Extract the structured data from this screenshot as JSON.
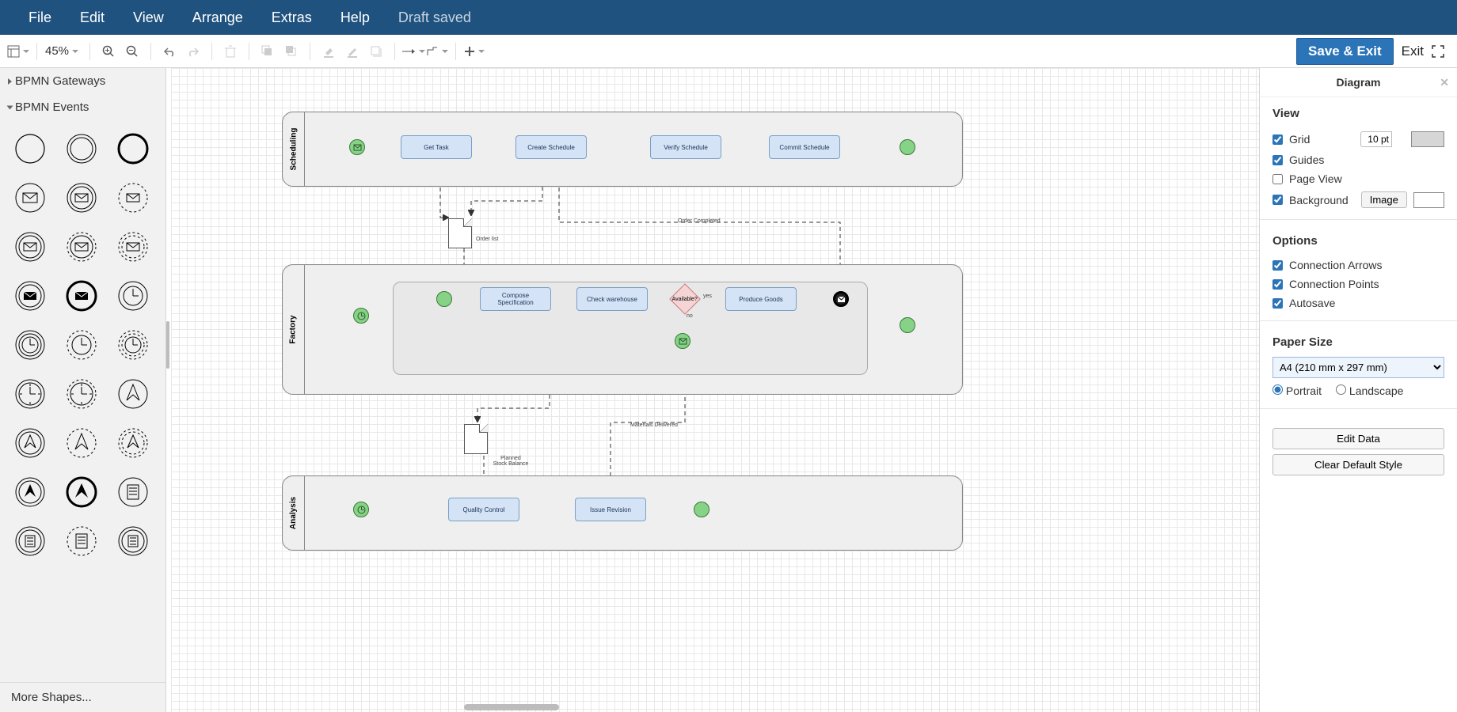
{
  "menubar": {
    "items": [
      "File",
      "Edit",
      "View",
      "Arrange",
      "Extras",
      "Help"
    ],
    "draft_saved": "Draft saved"
  },
  "toolbar": {
    "zoom": "45%",
    "save_exit": "Save & Exit",
    "exit": "Exit"
  },
  "sidebar": {
    "sections": [
      {
        "title": "BPMN Gateways",
        "expanded": false
      },
      {
        "title": "BPMN Events",
        "expanded": true
      }
    ],
    "more_shapes": "More Shapes..."
  },
  "props": {
    "header": "Diagram",
    "view_h": "View",
    "grid": "Grid",
    "grid_val": "10 pt",
    "guides": "Guides",
    "page_view": "Page View",
    "background": "Background",
    "image_btn": "Image",
    "options_h": "Options",
    "conn_arrows": "Connection Arrows",
    "conn_points": "Connection Points",
    "autosave": "Autosave",
    "paper_h": "Paper Size",
    "paper_sel": "A4 (210 mm x 297 mm)",
    "portrait": "Portrait",
    "landscape": "Landscape",
    "edit_data": "Edit Data",
    "clear_style": "Clear Default Style"
  },
  "diagram": {
    "lanes": [
      {
        "title": "Scheduling"
      },
      {
        "title": "Factory"
      },
      {
        "title": "Analysis"
      }
    ],
    "tasks": {
      "get_task": "Get Task",
      "create_schedule": "Create Schedule",
      "verify_schedule": "Verify Schedule",
      "commit_schedule": "Commit Schedule",
      "compose_spec": "Compose Specification",
      "check_wh": "Check warehouse",
      "produce_goods": "Produce Goods",
      "quality_ctrl": "Quality Control",
      "issue_rev": "Issue Revision"
    },
    "labels": {
      "order_list": "Order list",
      "order_completed": "Order Completed",
      "available": "Available?",
      "yes": "yes",
      "no": "no",
      "planned_stock": "Planned\nStock Balance",
      "materials_delivered": "Materials Delivered"
    }
  }
}
